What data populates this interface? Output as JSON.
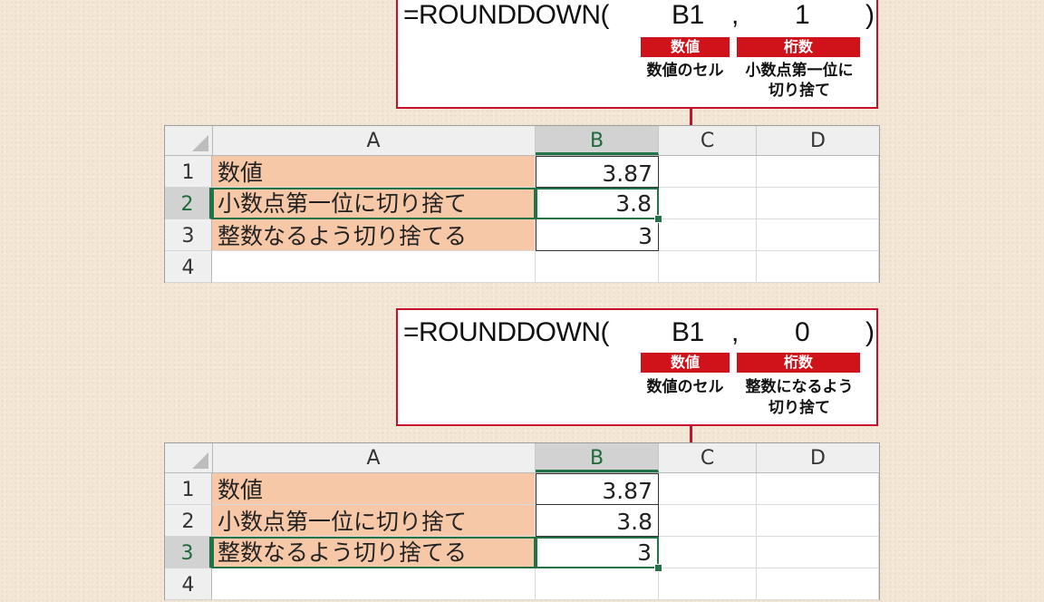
{
  "panels": [
    {
      "formula": {
        "func": "=ROUNDDOWN(",
        "arg1": "B1",
        "comma": ",",
        "arg2": "1",
        "close": ")"
      },
      "tags": {
        "number": "数値",
        "digits": "桁数"
      },
      "descriptions": {
        "number": "数値のセル",
        "digits_line1": "小数点第一位に",
        "digits_line2": "切り捨て"
      },
      "sheet": {
        "columns": [
          "A",
          "B",
          "C",
          "D"
        ],
        "selected_column": "B",
        "rows": [
          {
            "num": "1",
            "a": "数値",
            "b": "3.87"
          },
          {
            "num": "2",
            "a": "小数点第一位に切り捨て",
            "b": "3.8"
          },
          {
            "num": "3",
            "a": "整数なるよう切り捨てる",
            "b": "3"
          },
          {
            "num": "4",
            "a": "",
            "b": ""
          }
        ],
        "active_row": "2"
      }
    },
    {
      "formula": {
        "func": "=ROUNDDOWN(",
        "arg1": "B1",
        "comma": ",",
        "arg2": "0",
        "close": ")"
      },
      "tags": {
        "number": "数値",
        "digits": "桁数"
      },
      "descriptions": {
        "number": "数値のセル",
        "digits_line1": "整数になるよう",
        "digits_line2": "切り捨て"
      },
      "sheet": {
        "columns": [
          "A",
          "B",
          "C",
          "D"
        ],
        "selected_column": "B",
        "rows": [
          {
            "num": "1",
            "a": "数値",
            "b": "3.87"
          },
          {
            "num": "2",
            "a": "小数点第一位に切り捨て",
            "b": "3.8"
          },
          {
            "num": "3",
            "a": "整数なるよう切り捨てる",
            "b": "3"
          },
          {
            "num": "4",
            "a": "",
            "b": ""
          }
        ],
        "active_row": "3"
      }
    }
  ],
  "colors": {
    "accent_red": "#c8102e",
    "tag_red": "#d0121b",
    "cell_orange": "#f7c8a7",
    "excel_green": "#217346"
  }
}
